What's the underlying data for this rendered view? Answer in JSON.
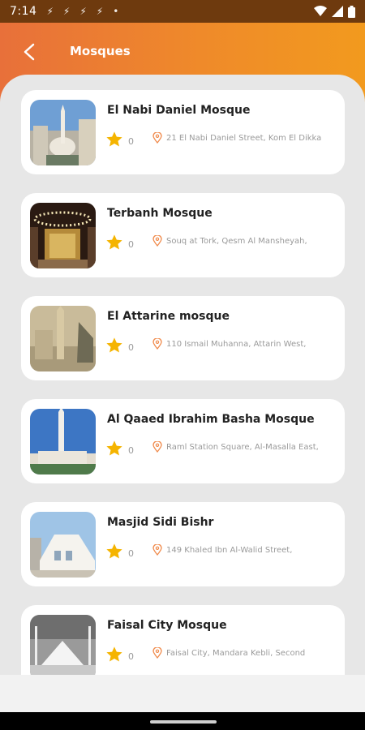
{
  "status_bar": {
    "time": "7:14",
    "notification_icons": [
      "notification-icon",
      "notification-icon",
      "notification-icon",
      "notification-icon",
      "dot-icon"
    ],
    "icons": [
      "wifi-icon",
      "signal-icon",
      "battery-icon"
    ]
  },
  "header": {
    "title": "Mosques",
    "back_icon": "back-arrow-icon"
  },
  "colors": {
    "accent_start": "#e8703a",
    "accent_end": "#f29a1e",
    "star": "#f5b400",
    "pin": "#f08a4b"
  },
  "mosques": [
    {
      "name": "El Nabi Daniel Mosque",
      "rating": "0",
      "address": "21 El Nabi Daniel Street, Kom El Dikka"
    },
    {
      "name": "Terbanh Mosque",
      "rating": "0",
      "address": "Souq at Tork, Qesm Al Mansheyah,"
    },
    {
      "name": "El Attarine mosque",
      "rating": "0",
      "address": "110 Ismail Muhanna, Attarin West,"
    },
    {
      "name": "Al Qaaed Ibrahim Basha Mosque",
      "rating": "0",
      "address": "Raml Station Square, Al-Masalla East,"
    },
    {
      "name": "Masjid Sidi Bishr",
      "rating": "0",
      "address": "149 Khaled Ibn Al-Walid Street,"
    },
    {
      "name": "Faisal City Mosque",
      "rating": "0",
      "address": "Faisal City, Mandara Kebli, Second"
    }
  ]
}
